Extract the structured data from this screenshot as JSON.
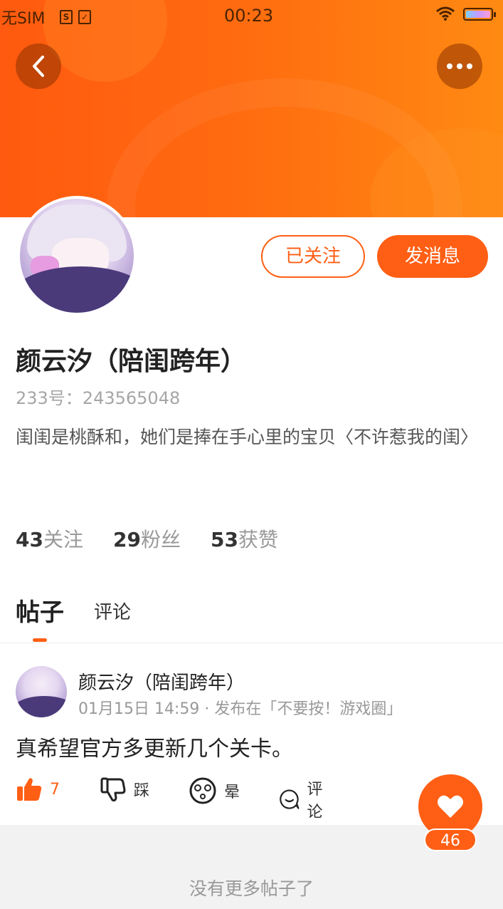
{
  "status_bar": {
    "carrier": "无SIM",
    "time": "00:23"
  },
  "profile": {
    "name": "颜云汐（陪闺跨年）",
    "uid_label": "233号：243565048",
    "bio": "闺闺是桃酥和，她们是捧在手心里的宝贝〈不许惹我的闺〉",
    "followed_button": "已关注",
    "message_button": "发消息",
    "stats": [
      {
        "num": "43",
        "label": "关注"
      },
      {
        "num": "29",
        "label": "粉丝"
      },
      {
        "num": "53",
        "label": "获赞"
      }
    ]
  },
  "tabs": {
    "posts": "帖子",
    "comments": "评论"
  },
  "post": {
    "author": "颜云汐（陪闺跨年）",
    "meta": "01月15日 14:59 · 发布在「不要按！游戏圈」",
    "text": "真希望官方多更新几个关卡。",
    "like_count": "7",
    "dislike_label": "踩",
    "dizzy_label": "晕",
    "comment_label": "评论"
  },
  "fab": {
    "count": "46"
  },
  "footer": {
    "text": "没有更多帖子了"
  },
  "colors": {
    "accent": "#ff5f15",
    "banner_start": "#ff5a0f",
    "banner_end": "#ff8a12"
  }
}
